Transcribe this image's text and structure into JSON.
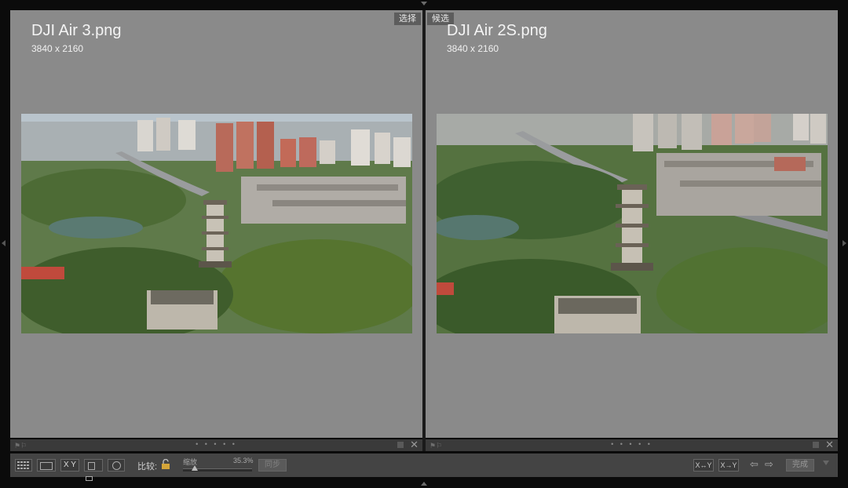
{
  "left": {
    "tag": "选择",
    "filename": "DJI Air 3.png",
    "dimensions": "3840 x 2160",
    "dots": "• • • • •"
  },
  "right": {
    "tag": "候选",
    "filename": "DJI Air 2S.png",
    "dimensions": "3840 x 2160",
    "dots": "• • • • •"
  },
  "toolbar": {
    "compare_label": "比较:",
    "zoom_label": "缩放",
    "zoom_value": "35.3%",
    "sync_label": "同步",
    "done_label": "完成",
    "xy_label": "X Y",
    "swap_left": "X↔Y",
    "swap_right": "X→Y"
  },
  "icons": [
    "grid-icon",
    "loupe-icon",
    "compare-icon",
    "survey-icon",
    "people-icon",
    "lock-icon",
    "flag-icon",
    "close-icon",
    "arrow-left-icon",
    "arrow-right-icon"
  ]
}
